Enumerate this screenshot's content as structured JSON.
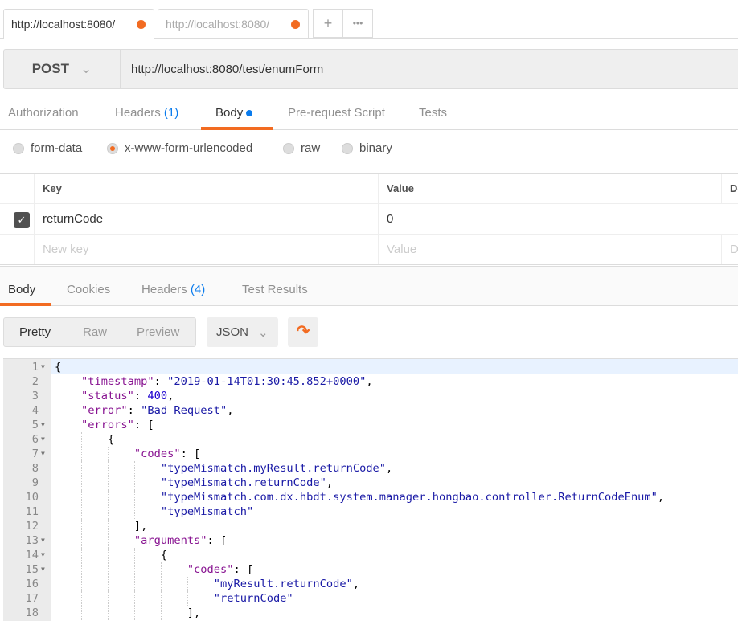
{
  "tabs": [
    {
      "label": "http://localhost:8080/",
      "active": true,
      "unsaved": true
    },
    {
      "label": "http://localhost:8080/",
      "active": false,
      "unsaved": true
    }
  ],
  "tab_actions": {
    "add": "+",
    "more": "•••"
  },
  "request": {
    "method": "POST",
    "url": "http://localhost:8080/test/enumForm"
  },
  "request_tabs": [
    {
      "label": "Authorization"
    },
    {
      "label": "Headers",
      "count": "(1)"
    },
    {
      "label": "Body",
      "active": true
    },
    {
      "label": "Pre-request Script"
    },
    {
      "label": "Tests"
    }
  ],
  "body_modes": [
    {
      "label": "form-data"
    },
    {
      "label": "x-www-form-urlencoded",
      "selected": true
    },
    {
      "label": "raw"
    },
    {
      "label": "binary"
    }
  ],
  "kv_table": {
    "headers": [
      "Key",
      "Value",
      "De"
    ],
    "rows": [
      {
        "key": "returnCode",
        "value": "0",
        "checked": true
      }
    ],
    "placeholder": {
      "key": "New key",
      "value": "Value",
      "desc": "D"
    }
  },
  "response_tabs": [
    {
      "label": "Body",
      "active": true
    },
    {
      "label": "Cookies"
    },
    {
      "label": "Headers",
      "count": "(4)"
    },
    {
      "label": "Test Results"
    }
  ],
  "view_modes": [
    "Pretty",
    "Raw",
    "Preview"
  ],
  "format": "JSON",
  "colors": {
    "accent": "#f26b21",
    "blue": "#097bed",
    "key": "#881391",
    "string": "#1a1aa6"
  },
  "code_lines": [
    {
      "n": "1",
      "fold": true,
      "i": 0,
      "t": [
        [
          "p",
          "{"
        ]
      ]
    },
    {
      "n": "2",
      "i": 1,
      "t": [
        [
          "k",
          "\"timestamp\""
        ],
        [
          "p",
          ": "
        ],
        [
          "s",
          "\"2019-01-14T01:30:45.852+0000\""
        ],
        [
          "p",
          ","
        ]
      ]
    },
    {
      "n": "3",
      "i": 1,
      "t": [
        [
          "k",
          "\"status\""
        ],
        [
          "p",
          ": "
        ],
        [
          "n",
          "400"
        ],
        [
          "p",
          ","
        ]
      ]
    },
    {
      "n": "4",
      "i": 1,
      "t": [
        [
          "k",
          "\"error\""
        ],
        [
          "p",
          ": "
        ],
        [
          "s",
          "\"Bad Request\""
        ],
        [
          "p",
          ","
        ]
      ]
    },
    {
      "n": "5",
      "fold": true,
      "i": 1,
      "t": [
        [
          "k",
          "\"errors\""
        ],
        [
          "p",
          ": ["
        ]
      ]
    },
    {
      "n": "6",
      "fold": true,
      "i": 2,
      "t": [
        [
          "p",
          "{"
        ]
      ]
    },
    {
      "n": "7",
      "fold": true,
      "i": 3,
      "t": [
        [
          "k",
          "\"codes\""
        ],
        [
          "p",
          ": ["
        ]
      ]
    },
    {
      "n": "8",
      "i": 4,
      "t": [
        [
          "s",
          "\"typeMismatch.myResult.returnCode\""
        ],
        [
          "p",
          ","
        ]
      ]
    },
    {
      "n": "9",
      "i": 4,
      "t": [
        [
          "s",
          "\"typeMismatch.returnCode\""
        ],
        [
          "p",
          ","
        ]
      ]
    },
    {
      "n": "10",
      "i": 4,
      "t": [
        [
          "s",
          "\"typeMismatch.com.dx.hbdt.system.manager.hongbao.controller.ReturnCodeEnum\""
        ],
        [
          "p",
          ","
        ]
      ]
    },
    {
      "n": "11",
      "i": 4,
      "t": [
        [
          "s",
          "\"typeMismatch\""
        ]
      ]
    },
    {
      "n": "12",
      "i": 3,
      "t": [
        [
          "p",
          "],"
        ]
      ]
    },
    {
      "n": "13",
      "fold": true,
      "i": 3,
      "t": [
        [
          "k",
          "\"arguments\""
        ],
        [
          "p",
          ": ["
        ]
      ]
    },
    {
      "n": "14",
      "fold": true,
      "i": 4,
      "t": [
        [
          "p",
          "{"
        ]
      ]
    },
    {
      "n": "15",
      "fold": true,
      "i": 5,
      "t": [
        [
          "k",
          "\"codes\""
        ],
        [
          "p",
          ": ["
        ]
      ]
    },
    {
      "n": "16",
      "i": 6,
      "t": [
        [
          "s",
          "\"myResult.returnCode\""
        ],
        [
          "p",
          ","
        ]
      ]
    },
    {
      "n": "17",
      "i": 6,
      "t": [
        [
          "s",
          "\"returnCode\""
        ]
      ]
    },
    {
      "n": "18",
      "i": 5,
      "t": [
        [
          "p",
          "],"
        ]
      ]
    }
  ]
}
